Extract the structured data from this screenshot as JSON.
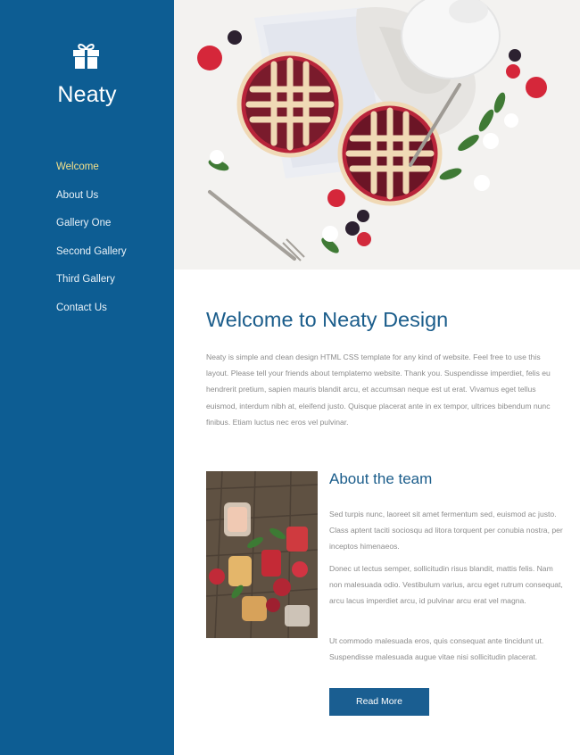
{
  "sidebar": {
    "logo_icon": "gift-icon",
    "brand": "Neaty",
    "nav": [
      {
        "label": "Welcome",
        "active": true
      },
      {
        "label": "About Us",
        "active": false
      },
      {
        "label": "Gallery One",
        "active": false
      },
      {
        "label": "Second Gallery",
        "active": false
      },
      {
        "label": "Third Gallery",
        "active": false
      },
      {
        "label": "Contact Us",
        "active": false
      }
    ]
  },
  "welcome": {
    "title": "Welcome to Neaty Design",
    "body": "Neaty is simple and clean design HTML CSS template for any kind of website. Feel free to use this layout. Please tell your friends about templatemo website. Thank you. Suspendisse imperdiet, felis eu hendrerit pretium, sapien mauris blandit arcu, et accumsan neque est ut erat. Vivamus eget tellus euismod, interdum nibh at, eleifend justo. Quisque placerat ante in ex tempor, ultrices bibendum nunc finibus. Etiam luctus nec eros vel pulvinar."
  },
  "team": {
    "title": "About the team",
    "paragraphs": [
      "Sed turpis nunc, laoreet sit amet fermentum sed, euismod ac justo. Class aptent taciti sociosqu ad litora torquent per conubia nostra, per inceptos himenaeos.",
      "Donec ut lectus semper, sollicitudin risus blandit, mattis felis. Nam non malesuada odio. Vestibulum varius, arcu eget rutrum consequat, arcu lacus imperdiet arcu, id pulvinar arcu erat vel magna.",
      "Ut commodo malesuada eros, quis consequat ante tincidunt ut. Suspendisse malesuada augue vitae nisi sollicitudin placerat."
    ],
    "button_label": "Read More"
  },
  "colors": {
    "sidebar_bg": "#0d5d93",
    "heading": "#1b5d8b",
    "active_nav": "#f3e08a",
    "button_bg": "#1a5e91",
    "body_text": "#8c8c8c"
  }
}
